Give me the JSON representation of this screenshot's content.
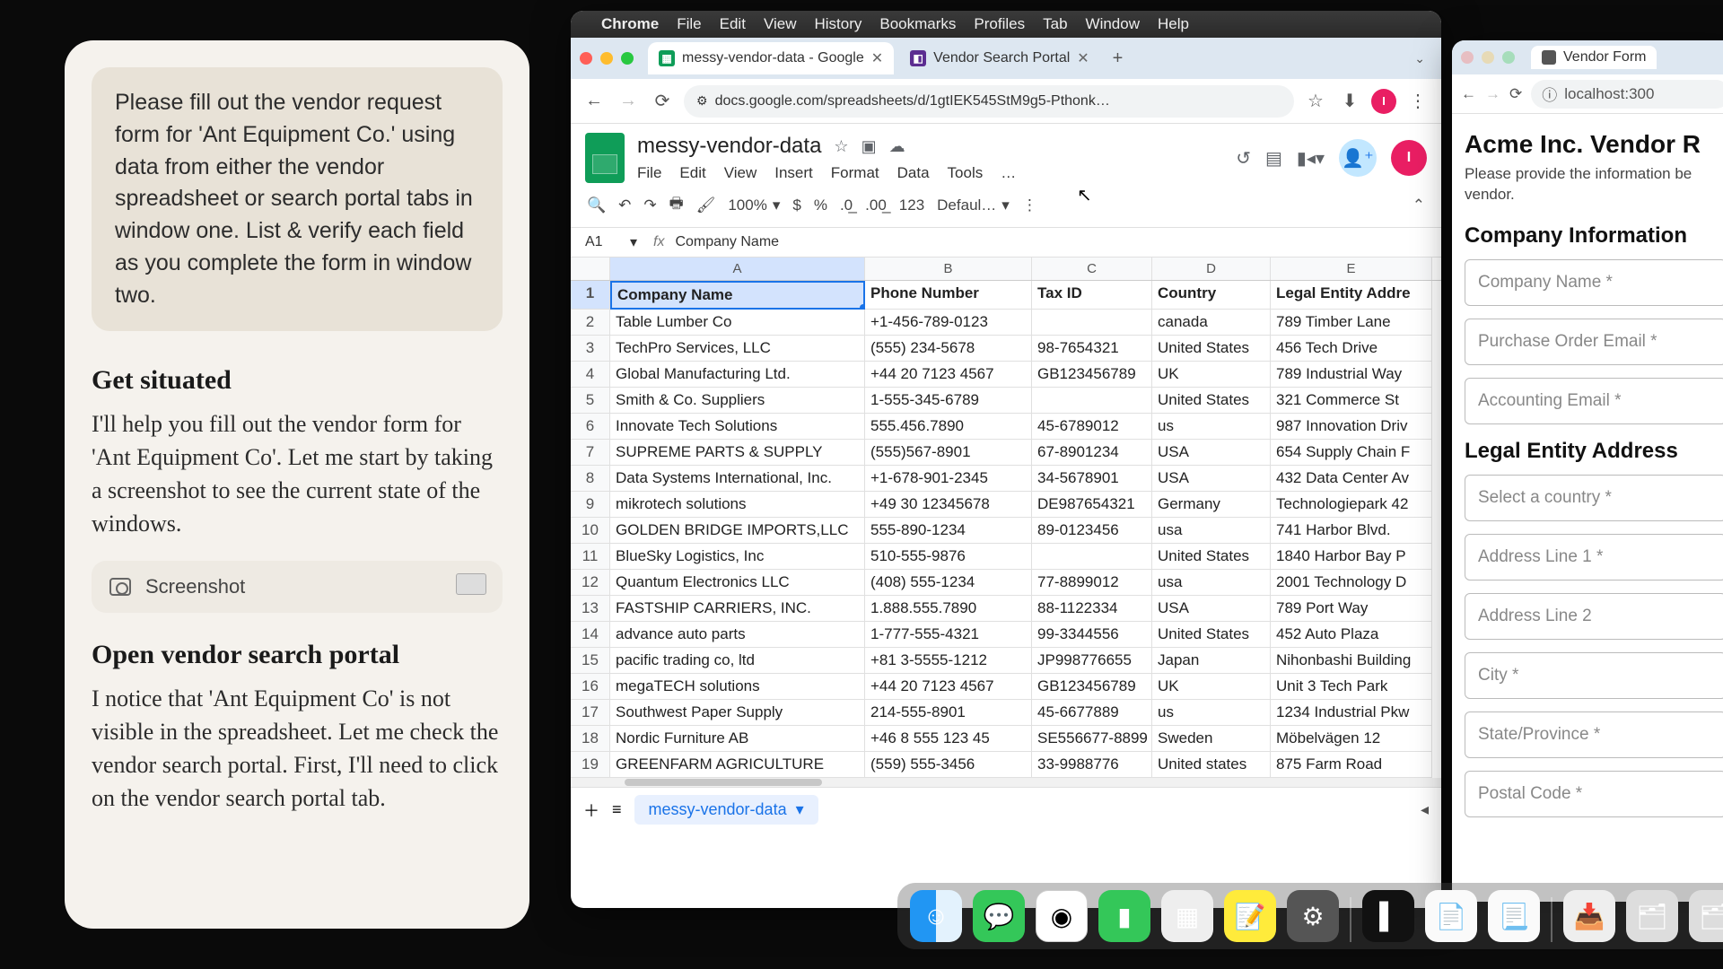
{
  "assistant": {
    "task": "Please fill out the vendor request form for 'Ant Equipment Co.' using data from either the vendor spreadsheet or search portal tabs in window one. List & verify each field as you complete the form in window two.",
    "sections": [
      {
        "title": "Get situated",
        "body": "I'll help you fill out the vendor form for 'Ant Equipment Co'. Let me start by taking a screenshot to see the current state of the windows."
      },
      {
        "title": "Open vendor search portal",
        "body": "I notice that 'Ant Equipment Co' is not visible in the spreadsheet. Let me check the vendor search portal. First, I'll need to click on the vendor search portal tab."
      }
    ],
    "screenshot_label": "Screenshot"
  },
  "mac_menu": {
    "app": "Chrome",
    "items": [
      "File",
      "Edit",
      "View",
      "History",
      "Bookmarks",
      "Profiles",
      "Tab",
      "Window",
      "Help"
    ]
  },
  "chrome": {
    "tabs": [
      {
        "title": "messy-vendor-data - Google",
        "active": true,
        "favicon": "sheets"
      },
      {
        "title": "Vendor Search Portal",
        "active": false,
        "favicon": "portal"
      }
    ],
    "url": "docs.google.com/spreadsheets/d/1gtIEK545StM9g5-Pthonk…",
    "avatar": "I"
  },
  "sheets": {
    "doc_title": "messy-vendor-data",
    "menus": [
      "File",
      "Edit",
      "View",
      "Insert",
      "Format",
      "Data",
      "Tools",
      "…"
    ],
    "toolbar": {
      "zoom": "100%",
      "currency": "$",
      "percent": "%",
      "dec1": ".0←",
      "dec2": ".00→",
      "numfmt": "123",
      "font": "Defaul…"
    },
    "namebox": "A1",
    "formula": "Company Name",
    "columns": [
      "A",
      "B",
      "C",
      "D",
      "E"
    ],
    "headers": [
      "Company Name",
      "Phone Number",
      "Tax ID",
      "Country",
      "Legal Entity Addre"
    ],
    "rows": [
      [
        "Table Lumber Co",
        "+1-456-789-0123",
        "",
        "canada",
        "789 Timber Lane"
      ],
      [
        "TechPro Services, LLC",
        "(555) 234-5678",
        "98-7654321",
        "United States",
        "456 Tech Drive"
      ],
      [
        "Global Manufacturing Ltd.",
        "+44 20 7123 4567",
        "GB123456789",
        "UK",
        "789 Industrial Way"
      ],
      [
        "Smith & Co. Suppliers",
        "1-555-345-6789",
        "",
        "United States",
        "321 Commerce St"
      ],
      [
        "Innovate Tech Solutions",
        "555.456.7890",
        "45-6789012",
        "us",
        "987 Innovation Driv"
      ],
      [
        "SUPREME PARTS & SUPPLY",
        "(555)567-8901",
        "67-8901234",
        "USA",
        "654 Supply Chain F"
      ],
      [
        "Data Systems International, Inc.",
        "+1-678-901-2345",
        "34-5678901",
        "USA",
        "432 Data Center Av"
      ],
      [
        "mikrotech solutions",
        "+49 30 12345678",
        "DE987654321",
        "Germany",
        "Technologiepark 42"
      ],
      [
        "GOLDEN BRIDGE IMPORTS,LLC",
        "555-890-1234",
        "89-0123456",
        "usa",
        "741 Harbor Blvd."
      ],
      [
        "BlueSky Logistics, Inc",
        "510-555-9876",
        "",
        "United States",
        "1840 Harbor Bay P"
      ],
      [
        "Quantum Electronics LLC",
        "(408) 555-1234",
        "77-8899012",
        "usa",
        "2001 Technology D"
      ],
      [
        "FASTSHIP CARRIERS, INC.",
        "1.888.555.7890",
        "88-1122334",
        "USA",
        "789 Port Way"
      ],
      [
        "advance auto parts",
        "1-777-555-4321",
        "99-3344556",
        "United States",
        "452 Auto Plaza"
      ],
      [
        "pacific trading co, ltd",
        "+81 3-5555-1212",
        "JP998776655",
        "Japan",
        "Nihonbashi Building"
      ],
      [
        "megaTECH solutions",
        "+44 20 7123 4567",
        "GB123456789",
        "UK",
        "Unit 3 Tech Park"
      ],
      [
        "Southwest Paper Supply",
        "214-555-8901",
        "45-6677889",
        "us",
        "1234 Industrial Pkw"
      ],
      [
        "Nordic Furniture AB",
        "+46 8 555 123 45",
        "SE556677-8899",
        "Sweden",
        "Möbelvägen 12"
      ],
      [
        "GREENFARM AGRICULTURE",
        "(559) 555-3456",
        "33-9988776",
        "United states",
        "875 Farm Road"
      ]
    ],
    "sheet_tab": "messy-vendor-data"
  },
  "form_window": {
    "tab_title": "Vendor Form",
    "url": "localhost:300",
    "title": "Acme Inc. Vendor R",
    "subtitle": "Please provide the information be vendor.",
    "section1": "Company Information",
    "fields1": [
      "Company Name *",
      "Purchase Order Email *",
      "Accounting Email *"
    ],
    "section2": "Legal Entity Address",
    "fields2": [
      "Select a country *",
      "Address Line 1 *",
      "Address Line 2",
      "City *",
      "State/Province *",
      "Postal Code *"
    ]
  },
  "dock": [
    "finder",
    "messages",
    "chrome",
    "facetime",
    "launchpad",
    "notes",
    "settings",
    "terminal",
    "textedit",
    "pages",
    "downloads",
    "desktop",
    "desktop2",
    "appstore",
    "trash"
  ]
}
